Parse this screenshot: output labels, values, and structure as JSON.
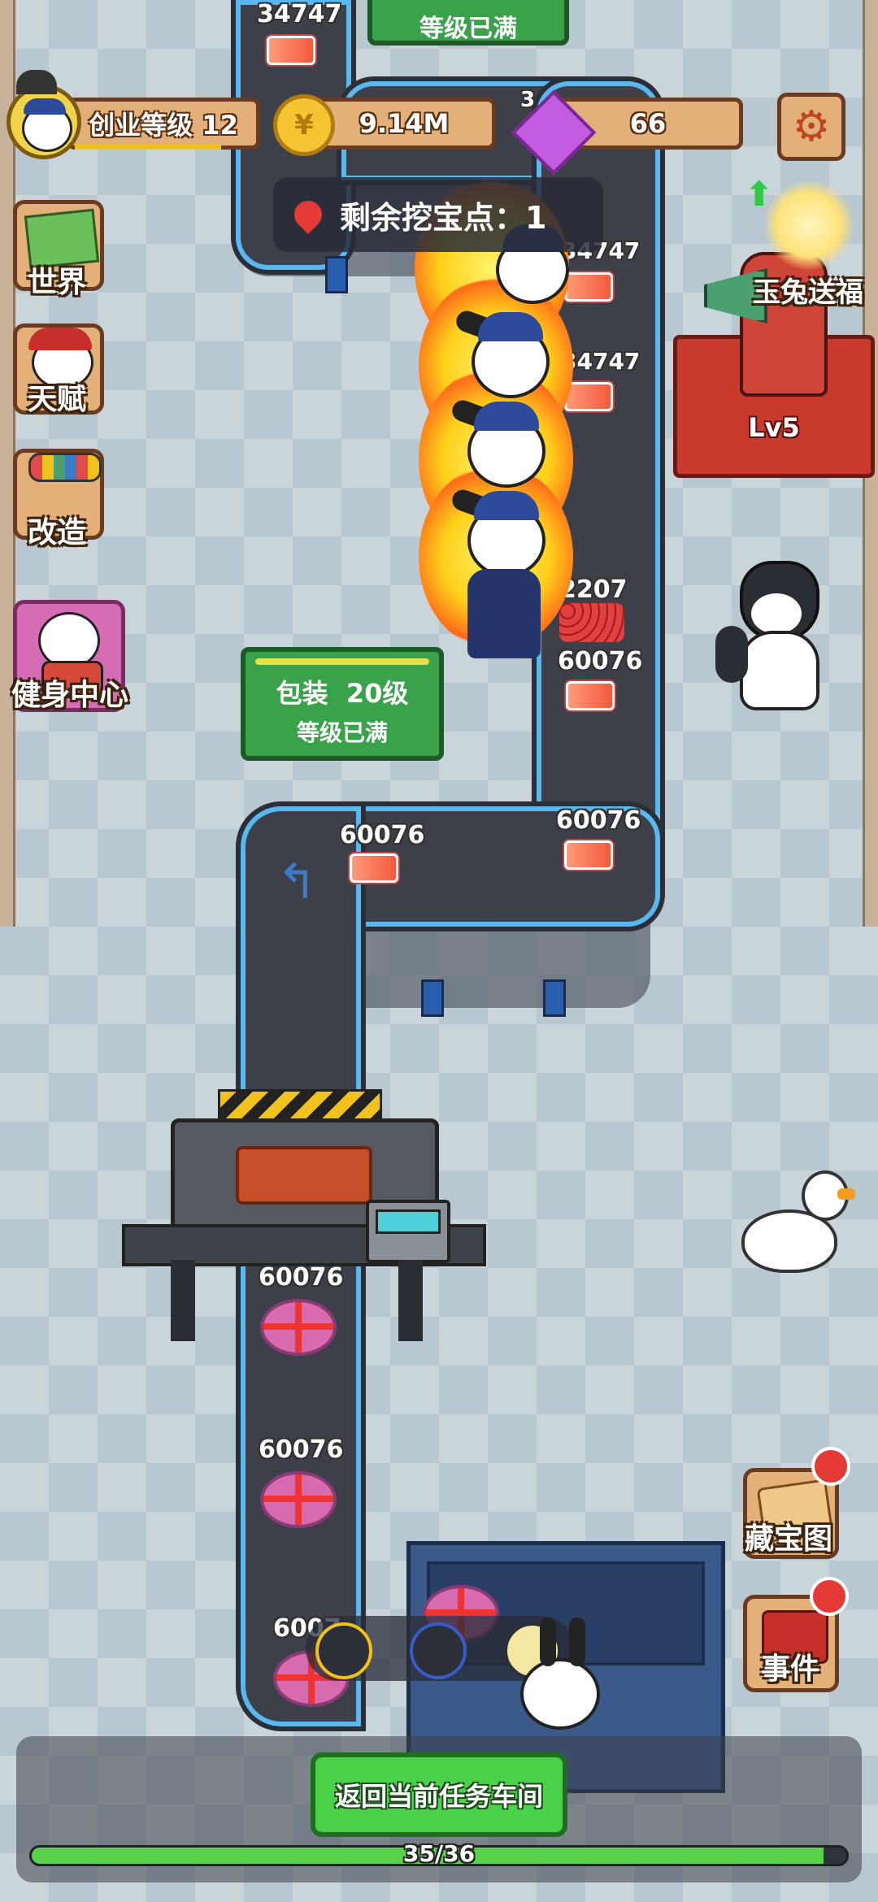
{
  "hud": {
    "level_label": "创业等级 12",
    "coins": "9.14M",
    "gems": "66",
    "overlap_digits": "3",
    "coin_symbol": "¥",
    "settings_icon": "gear-icon"
  },
  "side_menu": [
    {
      "label": "世界",
      "icon": "map-icon"
    },
    {
      "label": "天赋",
      "icon": "talent-icon"
    },
    {
      "label": "改造",
      "icon": "paint-roller-icon"
    },
    {
      "label": "健身中心",
      "icon": "gym-icon"
    }
  ],
  "dig_banner": {
    "text": "剩余挖宝点：1",
    "icon": "location-pin-icon"
  },
  "stations": {
    "top": {
      "status": "等级已满"
    },
    "packaging": {
      "title": "包装  20级",
      "status": "等级已满"
    }
  },
  "event_label": "玉兔送福",
  "event_level": "Lv5",
  "item_values": {
    "v34747": "34747",
    "v2207": "2207",
    "v60076": "60076",
    "partial": "6007"
  },
  "right_menu": [
    {
      "label": "藏宝图",
      "icon": "treasure-map-icon"
    },
    {
      "label": "事件",
      "icon": "scroll-icon"
    }
  ],
  "bottom": {
    "return_button": "返回当前任务车间",
    "progress_text": "35/36",
    "progress": 0.972
  },
  "colors": {
    "belt_edge": "#5ab8f0",
    "accent_green": "#4cd14a",
    "hud_wood": "#e3b07a"
  }
}
